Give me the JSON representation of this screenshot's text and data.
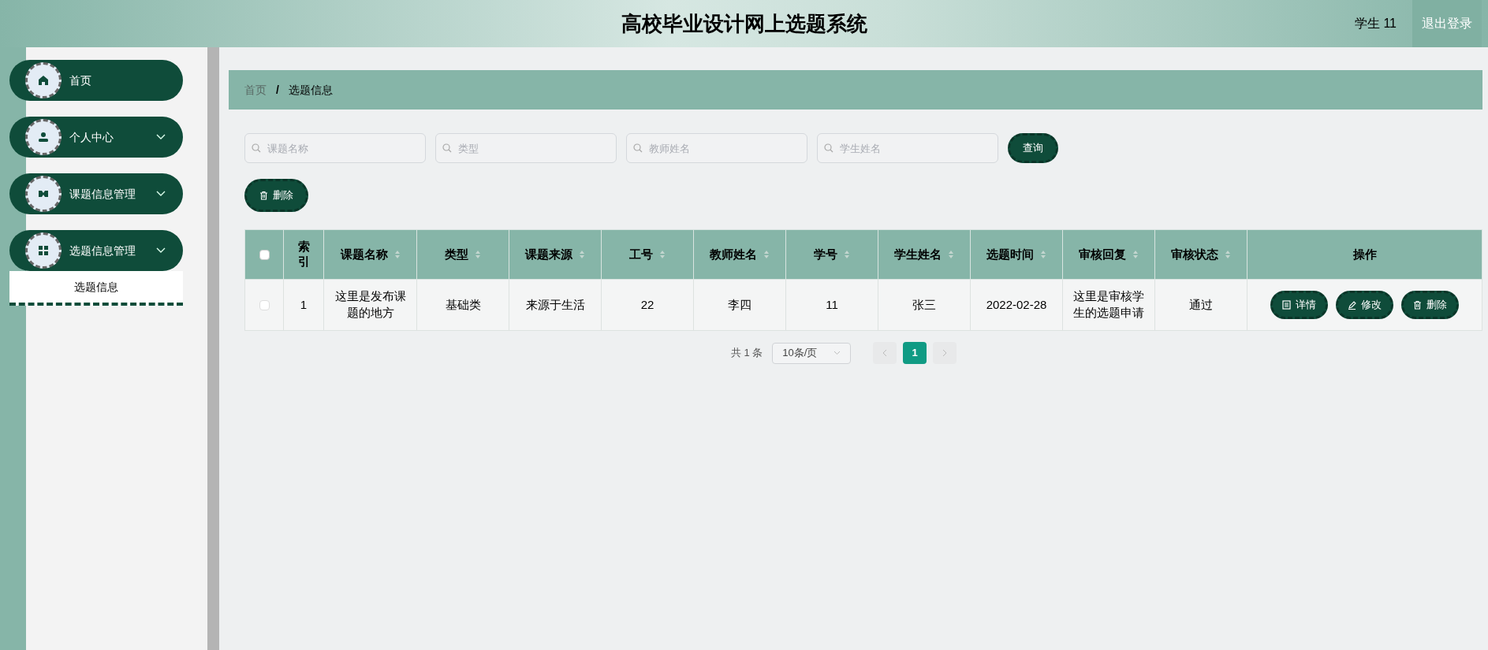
{
  "header": {
    "title": "高校毕业设计网上选题系统",
    "user": "学生 11",
    "logout": "退出登录"
  },
  "sidebar": {
    "items": [
      {
        "label": "首页",
        "has_submenu": false
      },
      {
        "label": "个人中心",
        "has_submenu": true
      },
      {
        "label": "课题信息管理",
        "has_submenu": true
      },
      {
        "label": "选题信息管理",
        "has_submenu": true,
        "expanded": true,
        "children": [
          {
            "label": "选题信息"
          }
        ]
      }
    ]
  },
  "breadcrumb": [
    "首页",
    "/",
    "选题信息"
  ],
  "search": {
    "fields": [
      {
        "placeholder": "课题名称"
      },
      {
        "placeholder": "类型"
      },
      {
        "placeholder": "教师姓名"
      },
      {
        "placeholder": "学生姓名"
      }
    ],
    "button": "查询"
  },
  "toolbar": {
    "delete": "删除"
  },
  "table": {
    "select_all_checked": false,
    "columns": [
      {
        "label": "索引",
        "sortable": false
      },
      {
        "label": "课题名称",
        "sortable": true
      },
      {
        "label": "类型",
        "sortable": true
      },
      {
        "label": "课题来源",
        "sortable": true
      },
      {
        "label": "工号",
        "sortable": true
      },
      {
        "label": "教师姓名",
        "sortable": true
      },
      {
        "label": "学号",
        "sortable": true
      },
      {
        "label": "学生姓名",
        "sortable": true
      },
      {
        "label": "选题时间",
        "sortable": true
      },
      {
        "label": "审核回复",
        "sortable": true
      },
      {
        "label": "审核状态",
        "sortable": true
      },
      {
        "label": "操作",
        "sortable": false
      }
    ],
    "rows": [
      {
        "checked": false,
        "cells": [
          "1",
          "这里是发布课题的地方",
          "基础类",
          "来源于生活",
          "22",
          "李四",
          "11",
          "张三",
          "2022-02-28",
          "这里是审核学生的选题申请",
          "通过"
        ],
        "actions": [
          "详情",
          "修改",
          "删除"
        ]
      }
    ]
  },
  "pagination": {
    "total": "共 1 条",
    "page_size": "10条/页",
    "pages": [
      {
        "label": "1",
        "selected": true
      }
    ]
  }
}
